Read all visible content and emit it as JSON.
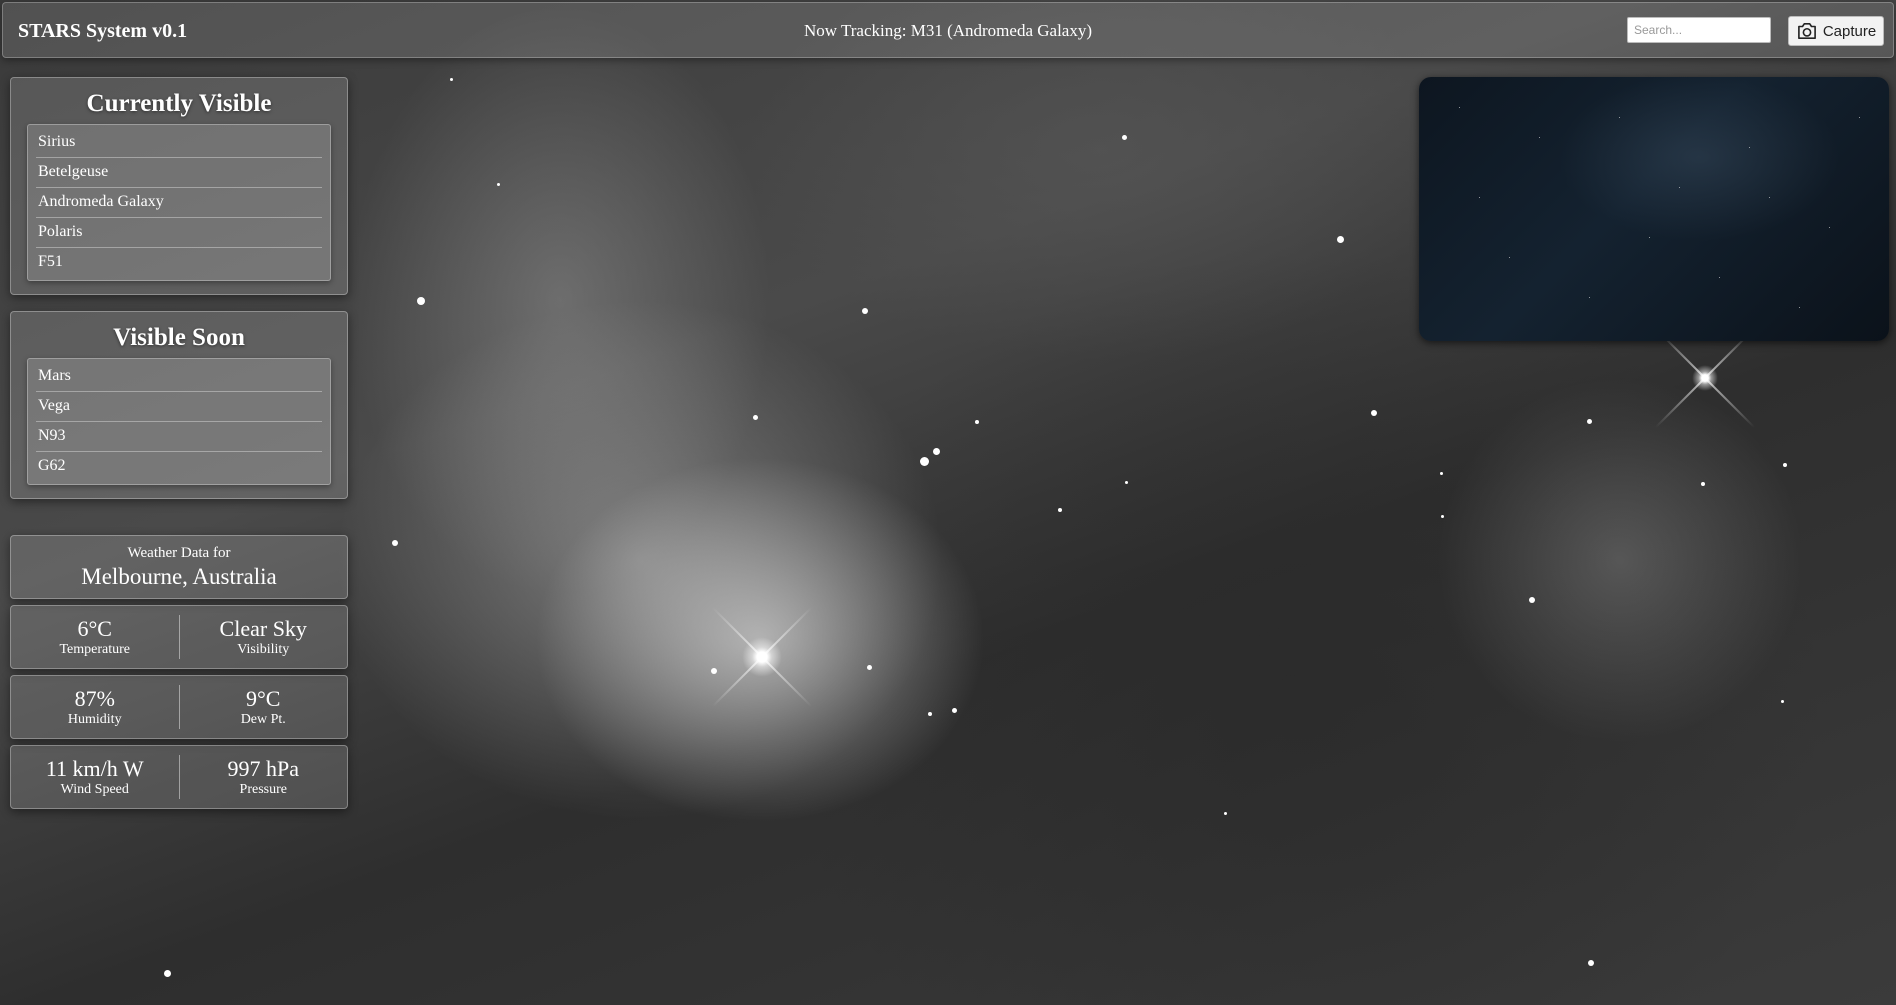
{
  "header": {
    "app_title": "STARS System v0.1",
    "tracking_text": "Now Tracking: M31 (Andromeda Galaxy)",
    "search_placeholder": "Search...",
    "capture_label": "Capture",
    "capture_icon": "camera-icon"
  },
  "currently_visible": {
    "title": "Currently Visible",
    "items": [
      "Sirius",
      "Betelgeuse",
      "Andromeda Galaxy",
      "Polaris",
      "F51"
    ]
  },
  "visible_soon": {
    "title": "Visible Soon",
    "items": [
      "Mars",
      "Vega",
      "N93",
      "G62"
    ]
  },
  "weather": {
    "heading": "Weather Data for",
    "location": "Melbourne, Australia",
    "rows": [
      [
        {
          "value": "6°C",
          "label": "Temperature"
        },
        {
          "value": "Clear Sky",
          "label": "Visibility"
        }
      ],
      [
        {
          "value": "87%",
          "label": "Humidity"
        },
        {
          "value": "9°C",
          "label": "Dew Pt."
        }
      ],
      [
        {
          "value": "11 km/h W",
          "label": "Wind Speed"
        },
        {
          "value": "997 hPa",
          "label": "Pressure"
        }
      ]
    ]
  }
}
